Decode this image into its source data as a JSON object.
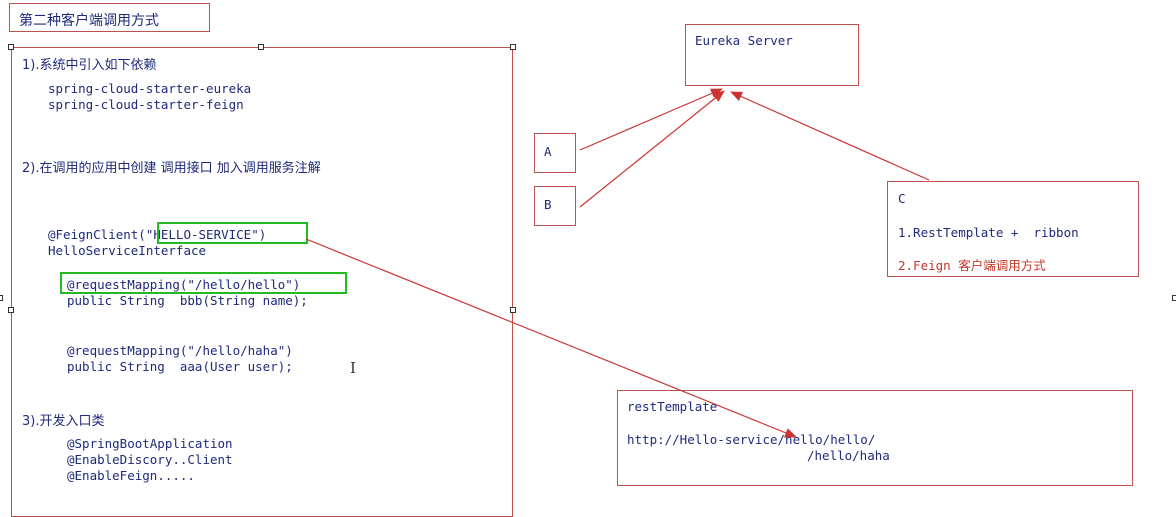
{
  "title": "第二种客户端调用方式",
  "main": {
    "step1": "1).系统中引入如下依赖",
    "dep1": "spring-cloud-starter-eureka",
    "dep2": "spring-cloud-starter-feign",
    "step2": "2).在调用的应用中创建  调用接口  加入调用服务注解",
    "feign_client": "@FeignClient(\"HELLO-SERVICE\")",
    "interface_name": "HelloServiceInterface",
    "mapping1": "@requestMapping(\"/hello/hello\")",
    "method1": "public String  bbb(String name);",
    "mapping2": "@requestMapping(\"/hello/haha\")",
    "method2": "public String  aaa(User user);",
    "step3": "3).开发入口类",
    "ann1": "@SpringBootApplication",
    "ann2": "@EnableDiscory..Client",
    "ann3": "@EnableFeign....."
  },
  "eureka": {
    "label": "Eureka Server"
  },
  "client_a": {
    "label": "A"
  },
  "client_b": {
    "label": "B"
  },
  "client_c": {
    "label": "C",
    "item1": "1.RestTemplate +  ribbon",
    "item2": "2.Feign 客户端调用方式"
  },
  "rest_template": {
    "label": "restTemplate",
    "url1": "http://Hello-service/hello/hello/",
    "url2": "/hello/haha"
  },
  "colors": {
    "border": "#c0504d",
    "arrow": "#cc3333",
    "highlight": "#22bb22",
    "text": "#1f2a7a",
    "red_text": "#c0392b"
  }
}
